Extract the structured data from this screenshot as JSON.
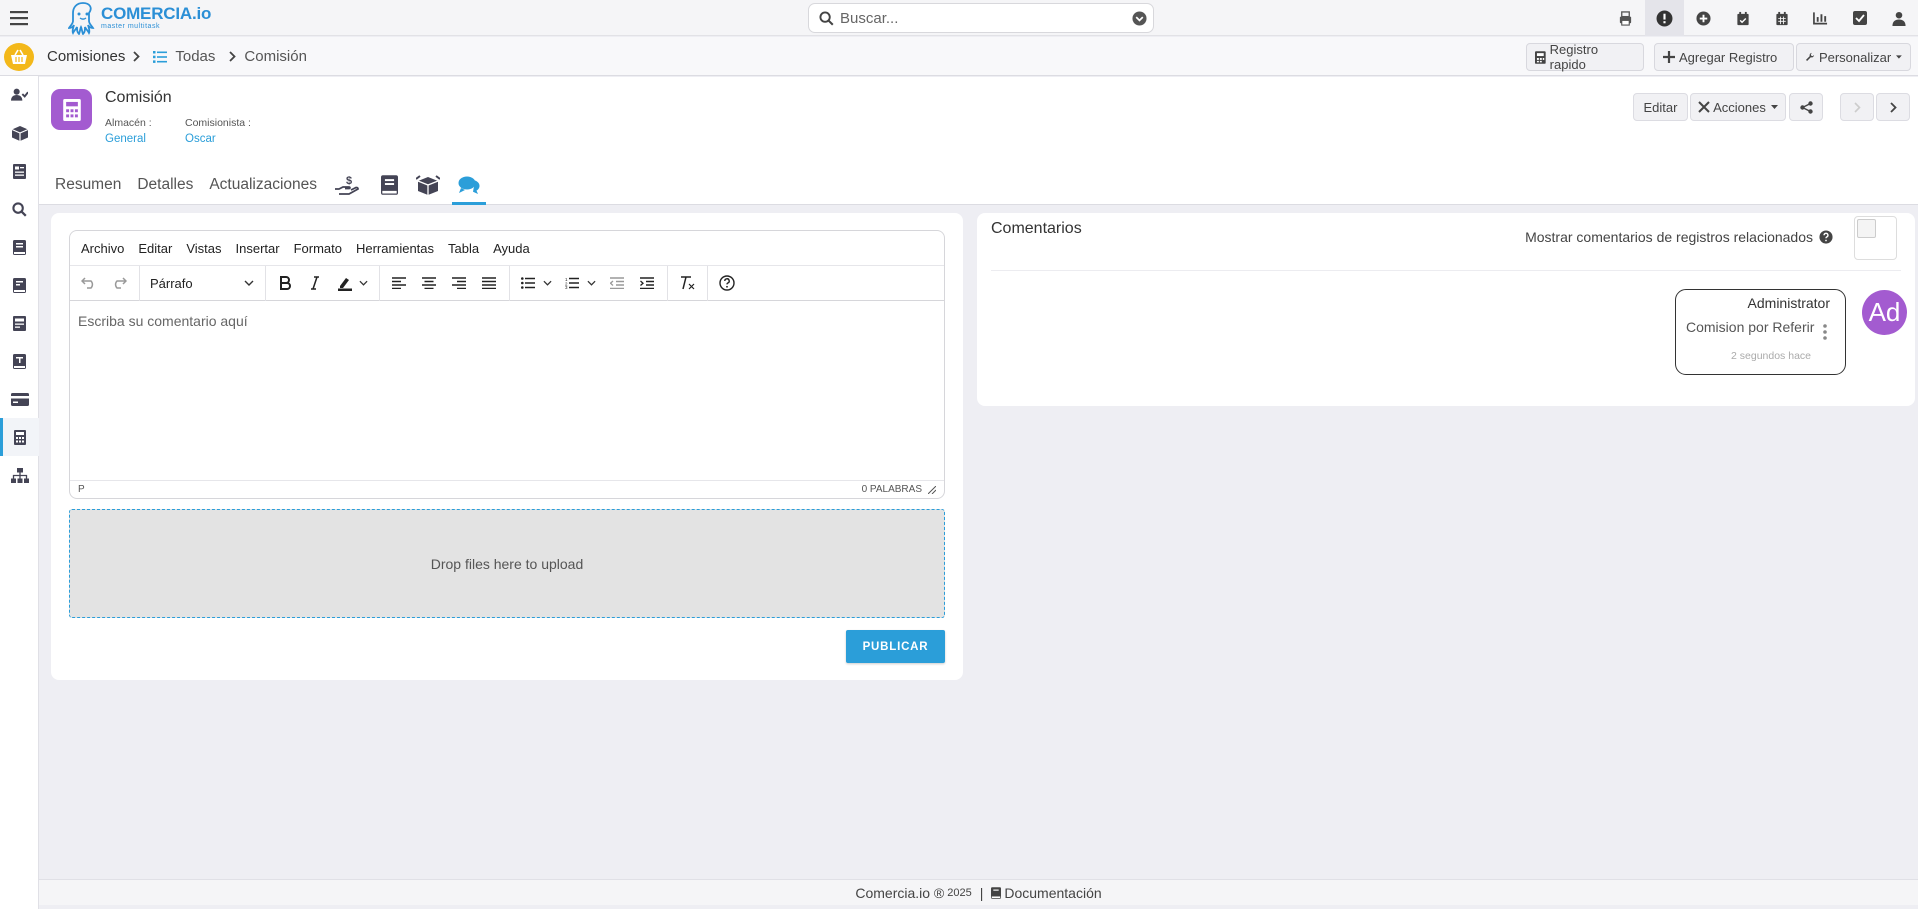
{
  "brand": {
    "name": "COMERCIA.io",
    "tagline": "master multitask"
  },
  "search": {
    "placeholder": "Buscar..."
  },
  "header_icons": [
    "printer-icon",
    "alert-icon",
    "plus-circle-icon",
    "calendar-check-icon",
    "calendar-icon",
    "chart-icon",
    "checkbox-icon",
    "user-icon"
  ],
  "breadcrumb": {
    "module": "Comisiones",
    "list": "Todas",
    "current": "Comisión"
  },
  "toolbar": {
    "quick": "Registro rapido",
    "add": "Agregar Registro",
    "customize": "Personalizar"
  },
  "sidebar": [
    "users-icon",
    "boxes-icon",
    "invoice-icon",
    "search-doc-icon",
    "book-icon",
    "book-icon",
    "invoice-icon",
    "book-icon",
    "credit-card-icon",
    "calculator-icon",
    "sitemap-icon"
  ],
  "record": {
    "title": "Comisión",
    "fields": [
      {
        "label": "Almacén :",
        "value": "General"
      },
      {
        "label": "Comisionista :",
        "value": "Oscar"
      }
    ],
    "edit": "Editar",
    "actions": "Acciones"
  },
  "tabs": [
    "Resumen",
    "Detalles",
    "Actualizaciones"
  ],
  "tab_icons": [
    "hand-dollar-icon",
    "book-icon",
    "boxes-icon",
    "comments-icon"
  ],
  "editor": {
    "menu": [
      "Archivo",
      "Editar",
      "Vistas",
      "Insertar",
      "Formato",
      "Herramientas",
      "Tabla",
      "Ayuda"
    ],
    "block_format": "Párrafo",
    "placeholder": "Escriba su comentario aquí",
    "path": "P",
    "word_count": "0 PALABRAS"
  },
  "dropzone": "Drop files here to upload",
  "publish": "PUBLICAR",
  "comments": {
    "title": "Comentarios",
    "show_related": "Mostrar comentarios de registros relacionados",
    "items": [
      {
        "author": "Administrator",
        "text": "Comision por Referir",
        "time": "2 segundos hace",
        "initials": "Ad"
      }
    ]
  },
  "footer": {
    "brand": "Comercia.io ®",
    "year": "2025",
    "docs": "Documentación"
  },
  "colors": {
    "accent": "#2b9ed9",
    "avatar": "#a35bd0",
    "basket": "#f3b81a"
  }
}
